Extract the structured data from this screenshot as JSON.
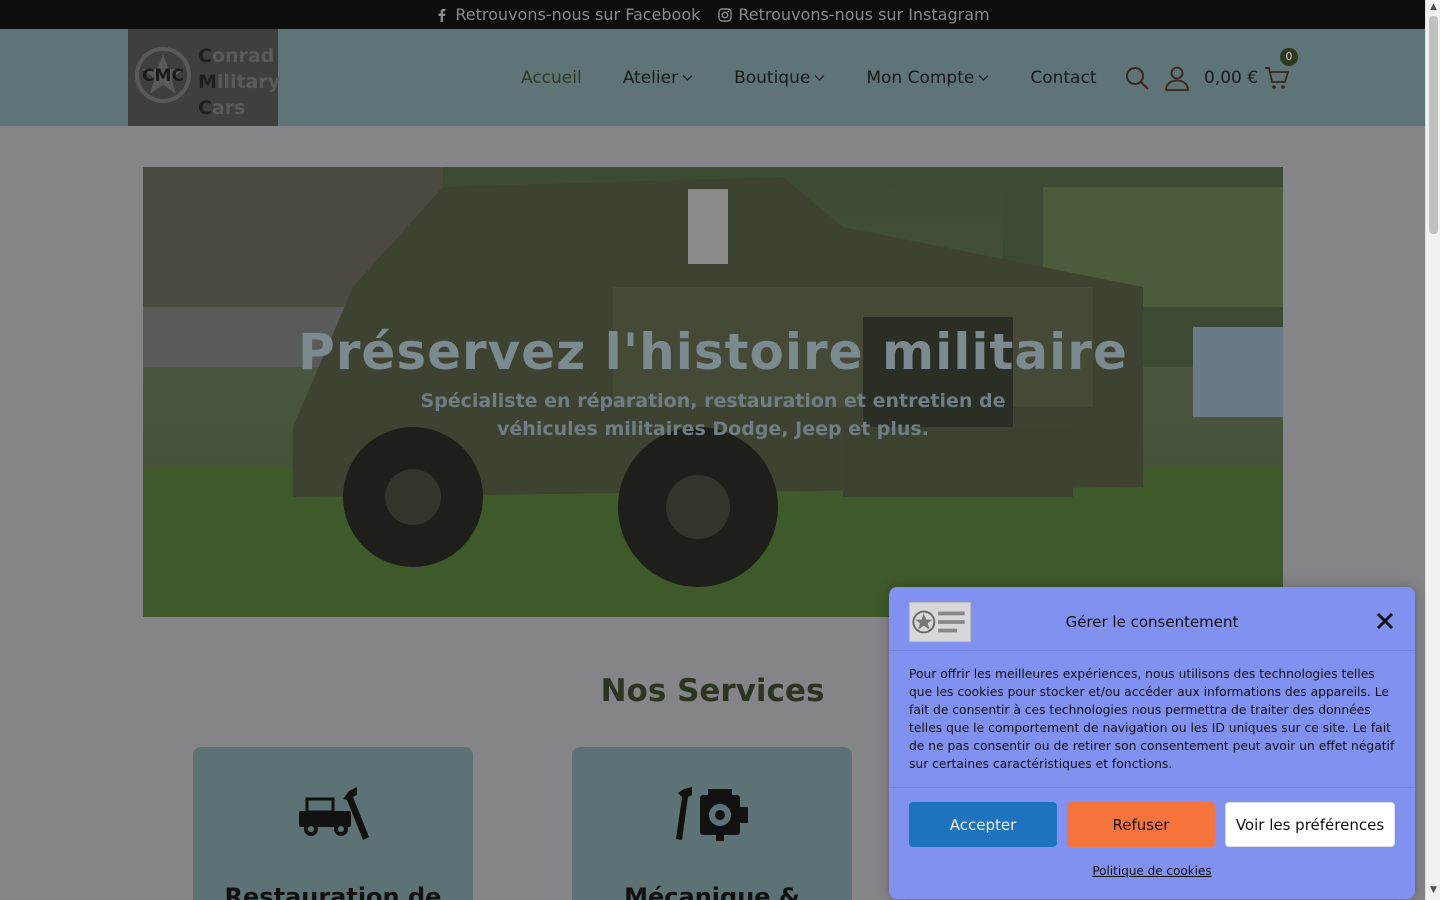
{
  "topbar": {
    "facebook_label": "Retrouvons-nous sur Facebook",
    "instagram_label": "Retrouvons-nous sur Instagram"
  },
  "logo": {
    "emblem_text": "CMC",
    "line1_initial": "C",
    "line1_rest": "onrad",
    "line2_initial": "M",
    "line2_rest": "ilitary",
    "line3_initial": "C",
    "line3_rest": "ars"
  },
  "nav": {
    "items": [
      {
        "label": "Accueil",
        "dropdown": false,
        "active": true
      },
      {
        "label": "Atelier",
        "dropdown": true
      },
      {
        "label": "Boutique",
        "dropdown": true
      },
      {
        "label": "Mon Compte",
        "dropdown": true
      },
      {
        "label": "Contact",
        "dropdown": false
      }
    ]
  },
  "header_tools": {
    "cart_total": "0,00 €",
    "cart_count": "0"
  },
  "hero": {
    "title": "Préservez l'histoire militaire",
    "subtitle": "Spécialiste en réparation, restauration et entretien de véhicules militaires Dodge, Jeep et plus."
  },
  "services": {
    "title": "Nos Services",
    "cards": [
      {
        "title": "Restauration de",
        "icon": "jeep-wrench-icon"
      },
      {
        "title": "Mécanique &",
        "icon": "engine-wrench-icon"
      }
    ]
  },
  "consent": {
    "title": "Gérer le consentement",
    "body": "Pour offrir les meilleures expériences, nous utilisons des technologies telles que les cookies pour stocker et/ou accéder aux informations des appareils. Le fait de consentir à ces technologies nous permettra de traiter des données telles que le comportement de navigation ou les ID uniques sur ce site. Le fait de ne pas consentir ou de retirer son consentement peut avoir un effet négatif sur certaines caractéristiques et fonctions.",
    "accept_label": "Accepter",
    "refuse_label": "Refuser",
    "prefs_label": "Voir les préférences",
    "policy_label": "Politique de cookies"
  },
  "colors": {
    "topbar_bg": "#0d0d0d",
    "header_bg": "#5e7476",
    "accent_green": "#2b3521",
    "consent_bg": "#8091ef",
    "accept_bg": "#1e73be",
    "refuse_bg": "#f4743b"
  }
}
